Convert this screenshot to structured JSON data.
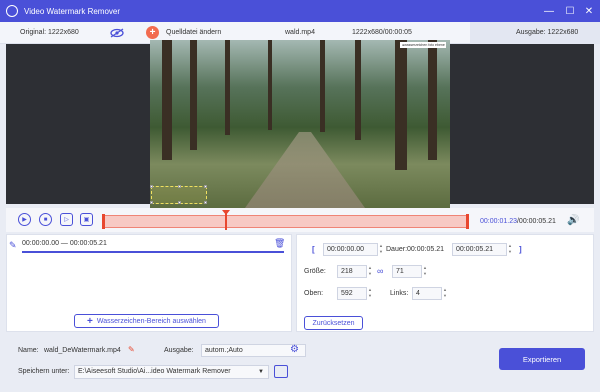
{
  "window": {
    "title": "Video Watermark Remover",
    "controls": {
      "minimize": "—",
      "maximize": "☐",
      "close": "✕"
    }
  },
  "subbar": {
    "original": "Original: 1222x680",
    "change_source": "Quelldatei ändern",
    "filename": "wald.mp4",
    "file_info": "1222x680/00:00:05",
    "output": "Ausgabe: 1222x680"
  },
  "preview": {
    "watermark_text": "●wasserzeichen foto ebene  ✕"
  },
  "playback": {
    "current_time": "00:00:01.23",
    "total_time": "/00:00:05.21"
  },
  "segment": {
    "range": "00:00:00.00 — 00:00:05.21"
  },
  "buttons": {
    "add_area": "Wasserzeichen-Bereich auswählen",
    "reset": "Zurücksetzen",
    "export": "Exportieren"
  },
  "settings": {
    "start": "00:00:00.00",
    "duration_label": "Dauer:00:00:05.21",
    "end": "00:00:05.21",
    "size_label": "Größe:",
    "width": "218",
    "height": "71",
    "top_label": "Oben:",
    "top": "592",
    "left_label": "Links:",
    "left": "4"
  },
  "bottom": {
    "name_label": "Name:",
    "name_value": "wald_DeWatermark.mp4",
    "output_label": "Ausgabe:",
    "output_value": "autom.;Auto",
    "save_label": "Speichern unter:",
    "save_path": "E:\\Aiseesoft Studio\\Ai...ideo Watermark Remover"
  },
  "colors": {
    "accent": "#4a50d8",
    "timeline": "#f7c9c4",
    "marker": "#e8472f"
  }
}
